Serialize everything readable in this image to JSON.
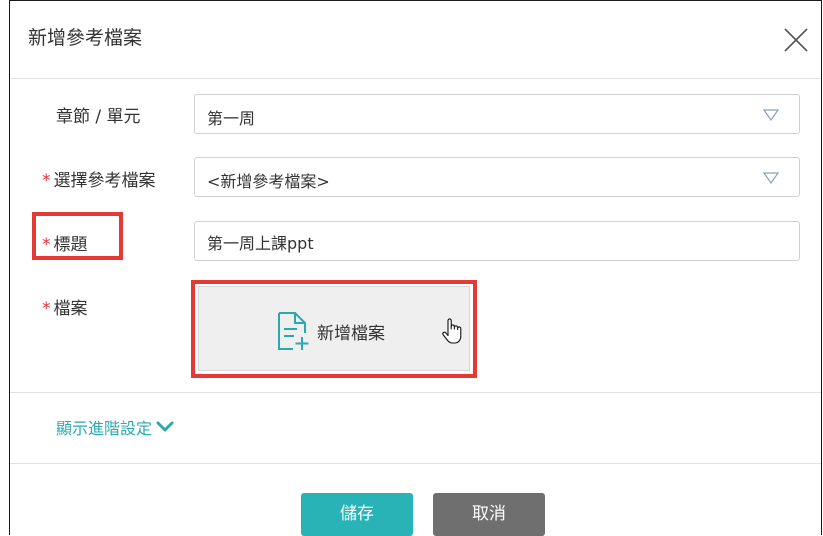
{
  "dialog": {
    "title": "新增參考檔案",
    "close_icon": "close-icon"
  },
  "form": {
    "chapter": {
      "label": "章節 / 單元",
      "value": "第一周"
    },
    "reference_file": {
      "required_mark": "*",
      "label": "選擇參考檔案",
      "value": "<新增參考檔案>"
    },
    "title": {
      "required_mark": "*",
      "label": "標題",
      "value": "第一周上課ppt"
    },
    "file": {
      "required_mark": "*",
      "label": "檔案",
      "button_label": "新增檔案",
      "icon": "add-file-icon"
    }
  },
  "advanced": {
    "label": "顯示進階設定",
    "icon": "chevron-down-icon"
  },
  "footer": {
    "save_label": "儲存",
    "cancel_label": "取消"
  },
  "colors": {
    "accent": "#29b3b6",
    "required": "#e0303a",
    "highlight": "#e53935",
    "cancel": "#6f6f6f"
  }
}
